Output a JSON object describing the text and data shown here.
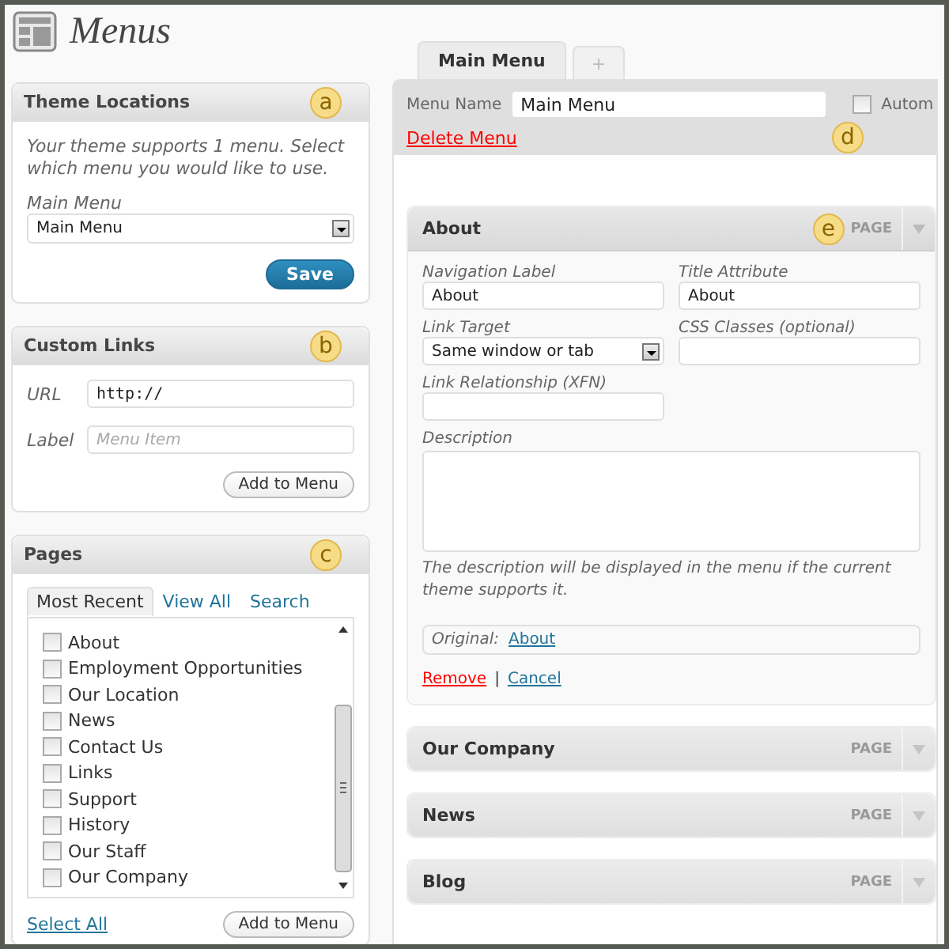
{
  "page_title": "Menus",
  "theme_locations": {
    "title": "Theme Locations",
    "callout": "a",
    "description": "Your theme supports 1 menu. Select which menu you would like to use.",
    "field_label": "Main Menu",
    "select_value": "Main Menu",
    "save_button": "Save"
  },
  "custom_links": {
    "title": "Custom Links",
    "callout": "b",
    "url_label": "URL",
    "url_value": "http://",
    "label_label": "Label",
    "label_placeholder": "Menu Item",
    "add_button": "Add to Menu"
  },
  "pages": {
    "title": "Pages",
    "callout": "c",
    "tabs": [
      {
        "label": "Most Recent",
        "selected": true
      },
      {
        "label": "View All",
        "selected": false
      },
      {
        "label": "Search",
        "selected": false
      }
    ],
    "items": [
      {
        "label": "About",
        "checked": false
      },
      {
        "label": "Employment Opportunities",
        "checked": false
      },
      {
        "label": "Our Location",
        "checked": false
      },
      {
        "label": "News",
        "checked": false
      },
      {
        "label": "Contact Us",
        "checked": false
      },
      {
        "label": "Links",
        "checked": false
      },
      {
        "label": "Support",
        "checked": false
      },
      {
        "label": "History",
        "checked": false
      },
      {
        "label": "Our Staff",
        "checked": false
      },
      {
        "label": "Our Company",
        "checked": false
      }
    ],
    "select_all": "Select All",
    "add_button": "Add to Menu"
  },
  "menu_tabs": [
    {
      "label": "Main Menu",
      "selected": true
    },
    {
      "label": "+",
      "selected": false
    }
  ],
  "menu_header": {
    "name_label": "Menu Name",
    "name_value": "Main Menu",
    "auto_label": "Autom",
    "auto_checked": false,
    "delete_link": "Delete Menu",
    "callout": "d"
  },
  "menu_items": [
    {
      "title": "About",
      "type": "PAGE",
      "expanded": true,
      "callout": "e",
      "settings": {
        "nav_label": "Navigation Label",
        "nav_value": "About",
        "title_attr_label": "Title Attribute",
        "title_attr_value": "About",
        "target_label": "Link Target",
        "target_value": "Same window or tab",
        "css_label": "CSS Classes (optional)",
        "xfn_label": "Link Relationship (XFN)",
        "description_label": "Description",
        "description_hint": "The description will be displayed in the menu if the current theme supports it.",
        "original_label": "Original:",
        "original_link": "About",
        "remove_link": "Remove",
        "separator": "|",
        "cancel_link": "Cancel"
      }
    },
    {
      "title": "Our Company",
      "type": "PAGE",
      "expanded": false
    },
    {
      "title": "News",
      "type": "PAGE",
      "expanded": false
    },
    {
      "title": "Blog",
      "type": "PAGE",
      "expanded": false
    }
  ]
}
